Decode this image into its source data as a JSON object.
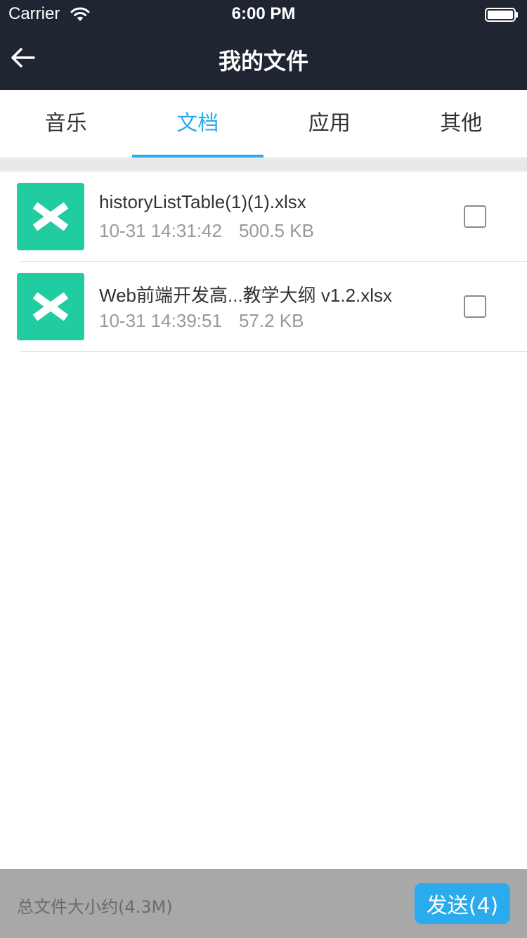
{
  "status_bar": {
    "carrier": "Carrier",
    "time": "6:00 PM"
  },
  "nav": {
    "title": "我的文件",
    "back_icon": "arrow-left-icon"
  },
  "tabs": [
    {
      "label": "音乐",
      "active": false
    },
    {
      "label": "文档",
      "active": true
    },
    {
      "label": "应用",
      "active": false
    },
    {
      "label": "其他",
      "active": false
    }
  ],
  "files": [
    {
      "name": "historyListTable(1)(1).xlsx",
      "date": "10-31 14:31:42",
      "size": "500.5 KB",
      "icon": "excel-file-icon",
      "checked": false
    },
    {
      "name": "Web前端开发高...教学大纲 v1.2.xlsx",
      "date": "10-31 14:39:51",
      "size": "57.2 KB",
      "icon": "excel-file-icon",
      "checked": false
    }
  ],
  "footer": {
    "total_size": "总文件大小约(4.3M)",
    "send_label": "发送(4)"
  },
  "colors": {
    "header_bg": "#1f2631",
    "accent": "#2aabee",
    "excel_icon": "#21cca0",
    "footer_bg": "#a8a8a8"
  }
}
